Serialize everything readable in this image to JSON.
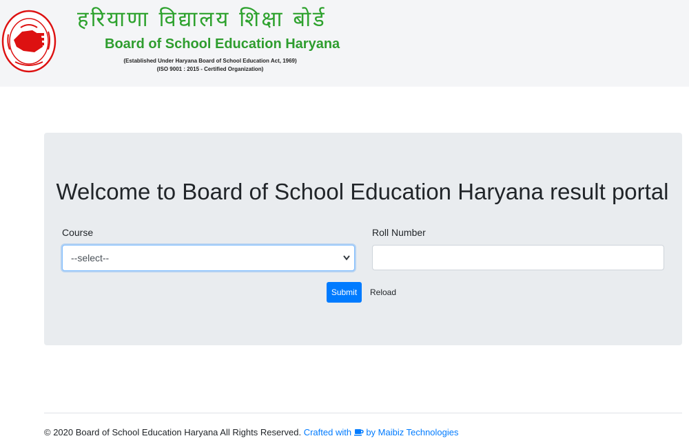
{
  "header": {
    "hindi_title": "हरियाणा विद्यालय शिक्षा बोर्ड",
    "english_title": "Board of School Education Haryana",
    "established_line": "(Established Under Haryana Board of School Education Act, 1969)",
    "iso_line": "(ISO 9001 : 2015 - Certified Organization)"
  },
  "main": {
    "welcome_heading": "Welcome to Board of School Education Haryana result portal",
    "course_label": "Course",
    "course_selected": "--select--",
    "roll_label": "Roll Number",
    "roll_value": "",
    "submit_label": "Submit",
    "reload_label": "Reload"
  },
  "footer": {
    "copyright": "© 2020 Board of School Education Haryana All Rights Reserved.",
    "crafted_with": "Crafted with",
    "by_company": "by Maibiz Technologies"
  },
  "icons": {
    "logo": "bseh-seal-logo",
    "select_arrow": "chevron-down-icon",
    "cup": "coffee-cup-icon"
  },
  "colors": {
    "brand_green": "#2ea22e",
    "primary_blue": "#007bff",
    "panel_bg": "#e9ecef",
    "header_bg": "#f4f5f7"
  }
}
